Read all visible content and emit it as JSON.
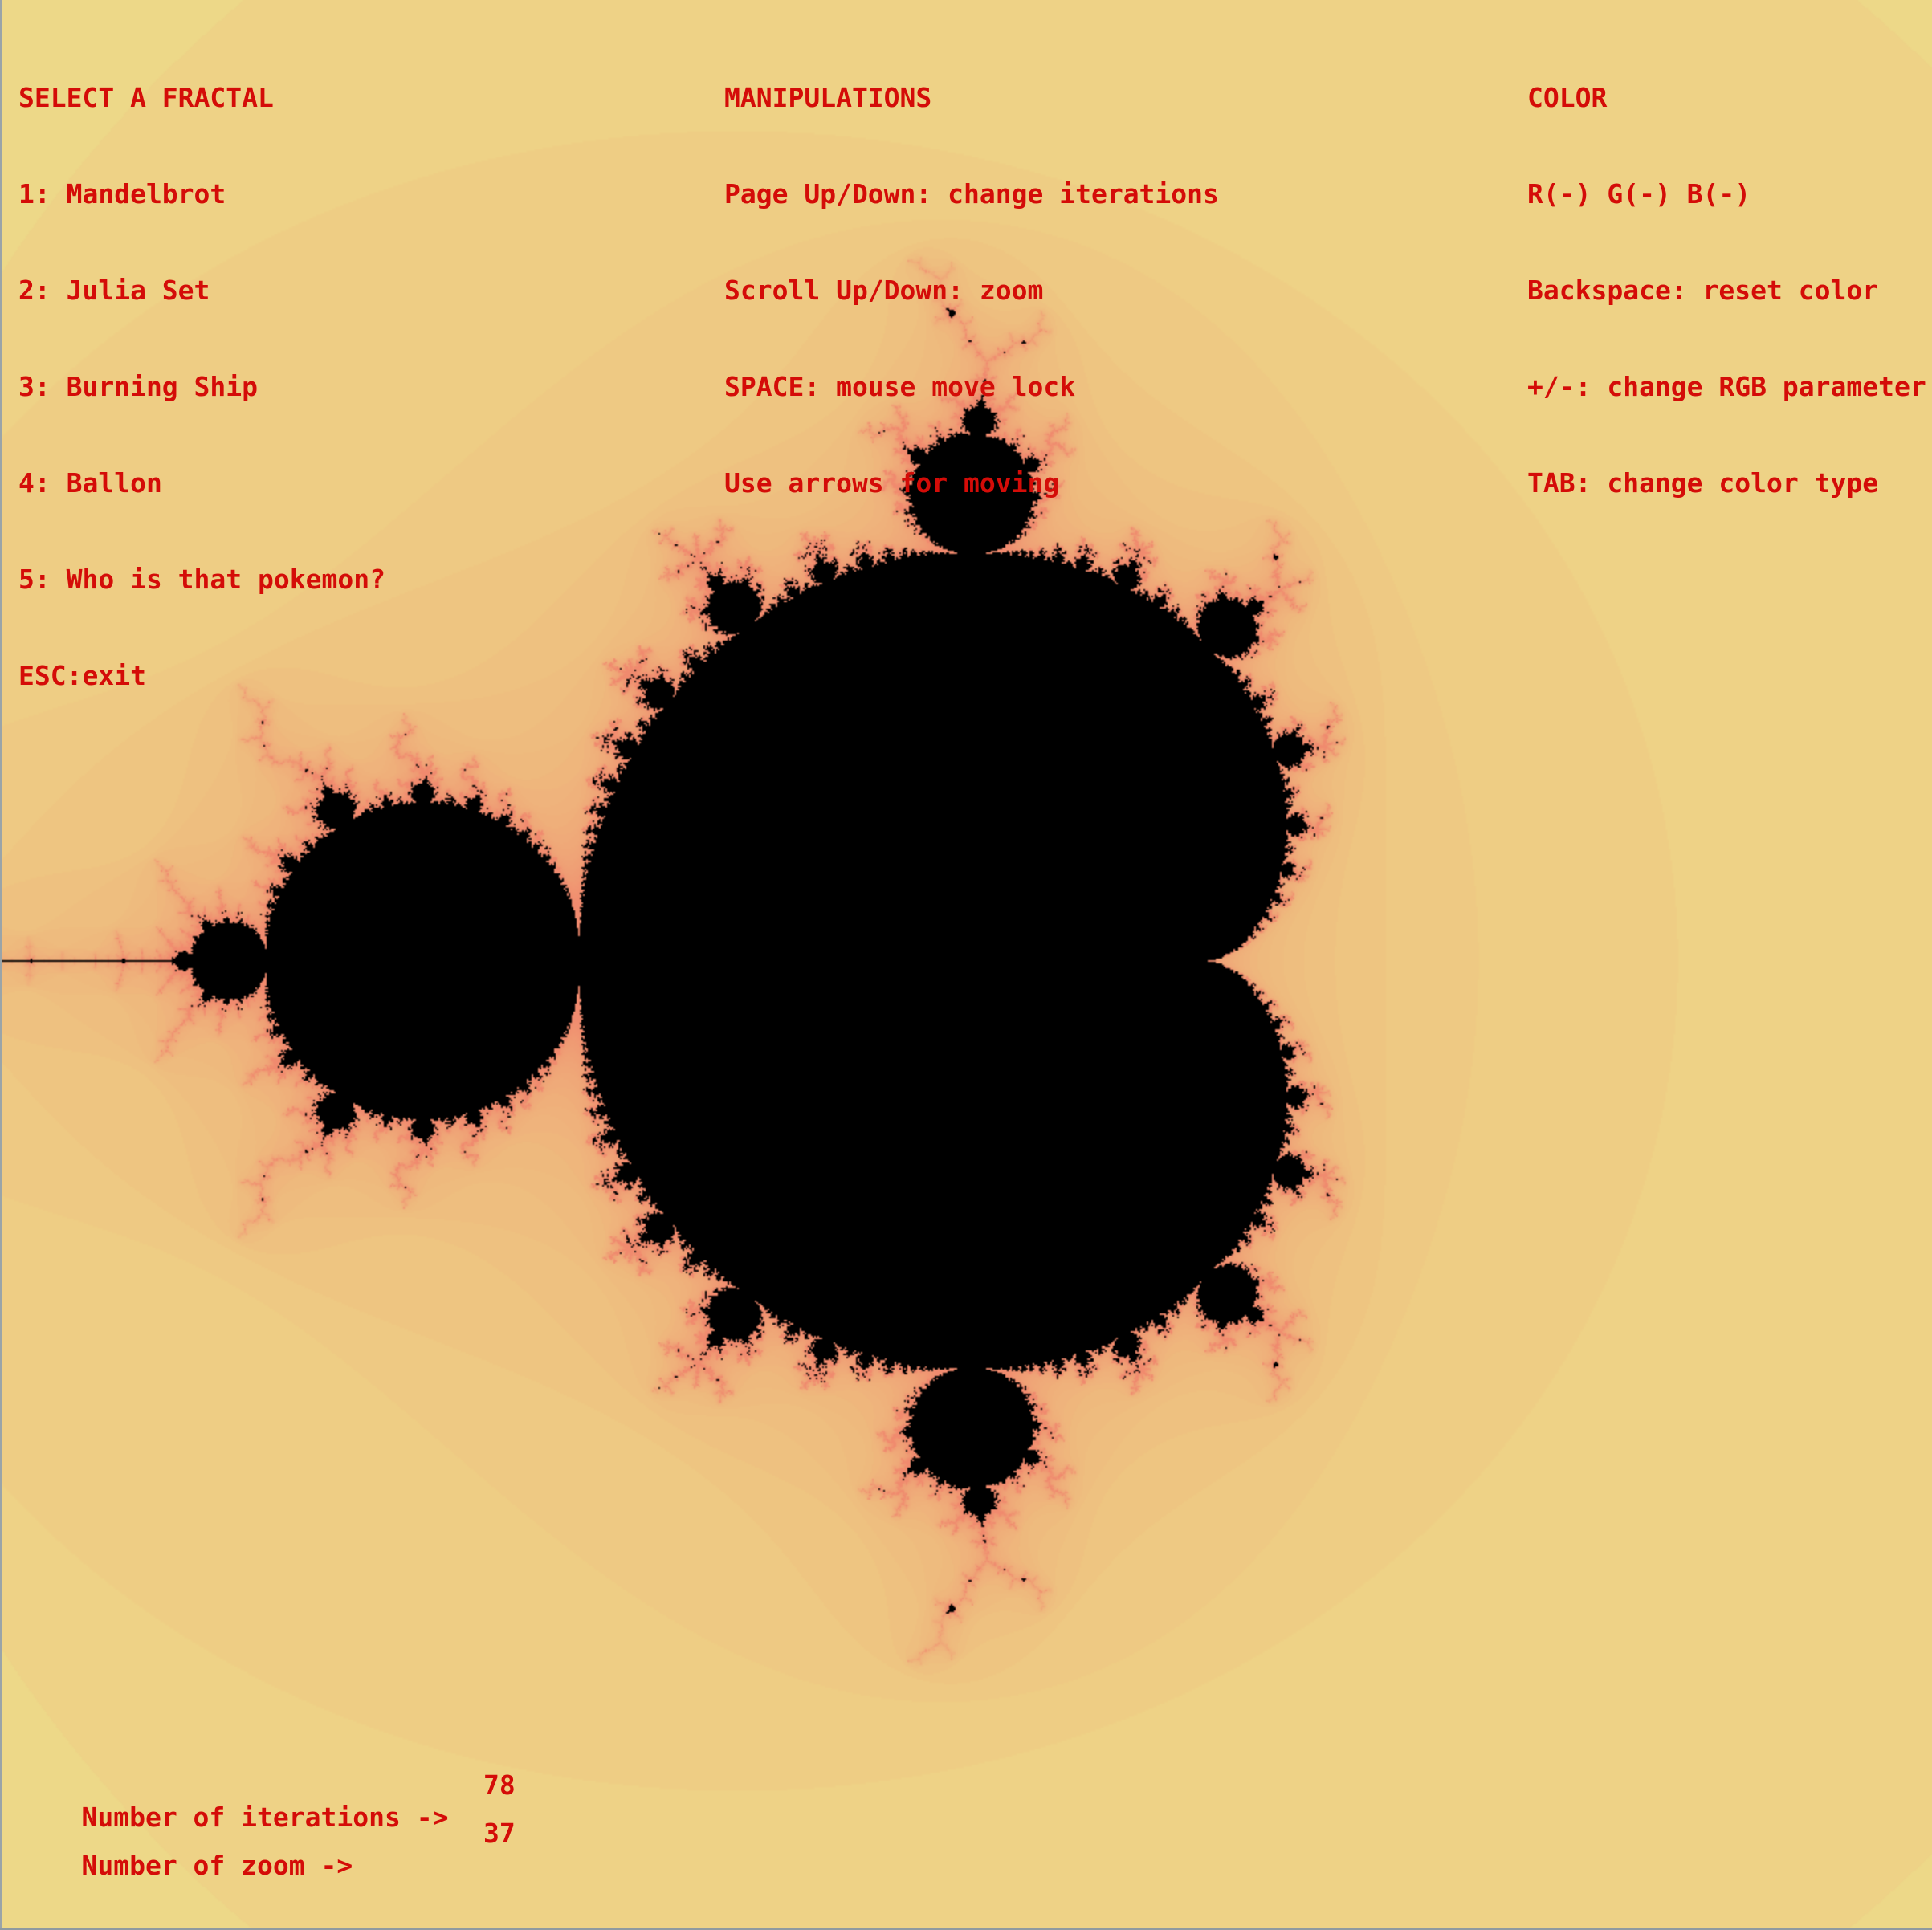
{
  "fractal": {
    "type": "Mandelbrot",
    "iterations": 78,
    "colors": {
      "background": "#ede58c",
      "edge": "#f08a6e",
      "set": "#000000",
      "text": "#d40c08"
    }
  },
  "menus": {
    "fractals": {
      "title": "SELECT A FRACTAL",
      "items": [
        "1: Mandelbrot",
        "2: Julia Set",
        "3: Burning Ship",
        "4: Ballon",
        "5: Who is that pokemon?",
        "ESC:exit"
      ]
    },
    "manipulations": {
      "title": "MANIPULATIONS",
      "items": [
        "Page Up/Down: change iterations",
        "Scroll Up/Down: zoom",
        "SPACE: mouse move lock",
        "Use arrows for moving"
      ]
    },
    "color": {
      "title": "COLOR",
      "items": [
        "R(-) G(-) B(-)",
        "Backspace: reset color",
        "+/-: change RGB parameter",
        "TAB: change color type"
      ]
    }
  },
  "stats": {
    "iterations_label": "Number of iterations ->",
    "iterations_value": "78",
    "zoom_label": "Number of zoom ->",
    "zoom_value": "37"
  }
}
